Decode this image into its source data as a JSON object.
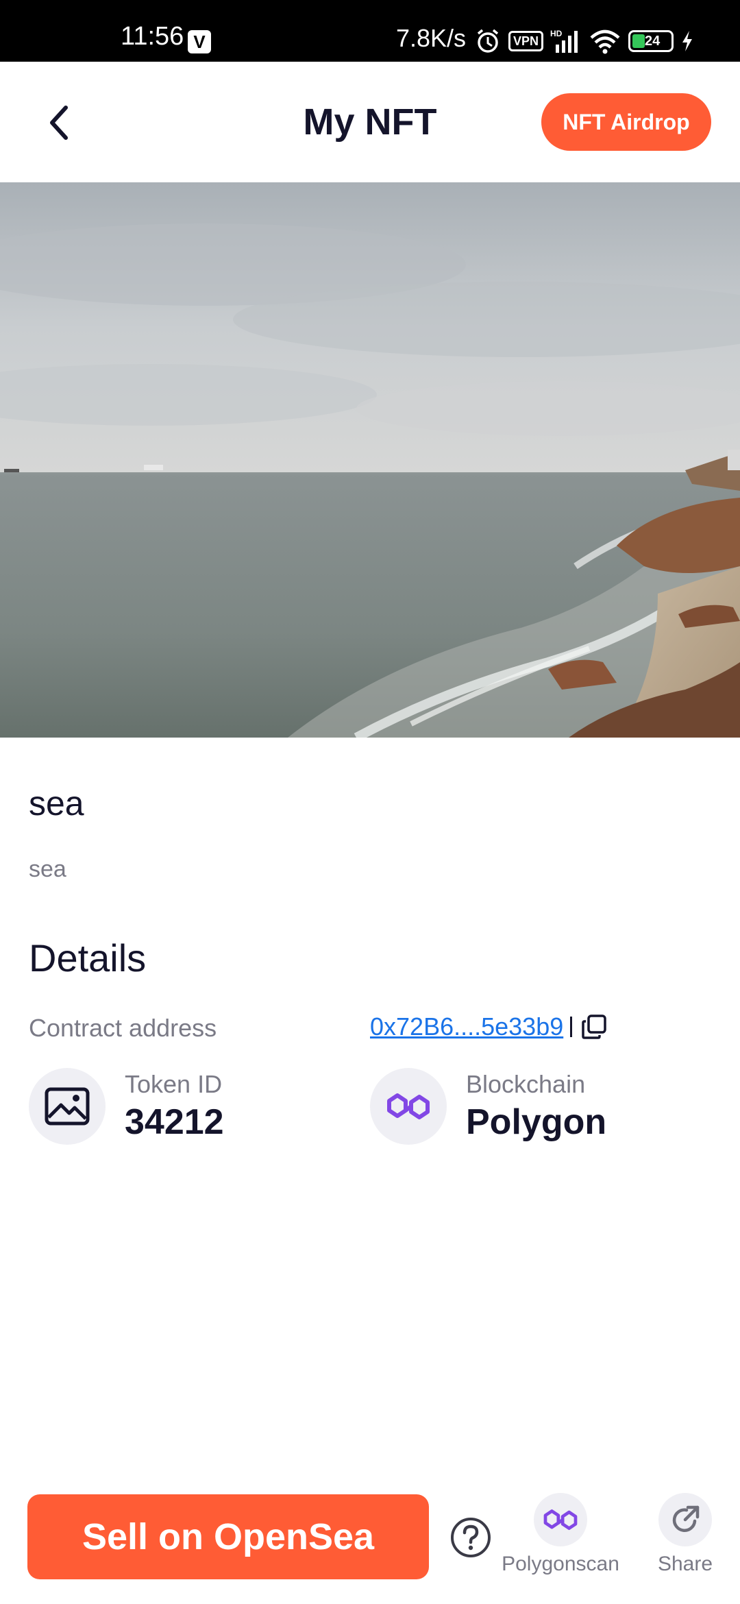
{
  "status_bar": {
    "time": "11:56",
    "notification_badge": "V",
    "network_speed": "7.8K/s",
    "vpn": "VPN",
    "battery": "24",
    "icons": [
      "alarm-icon",
      "vpn-icon",
      "signal-icon",
      "wifi-icon",
      "battery-icon",
      "charging-icon"
    ]
  },
  "header": {
    "title": "My NFT",
    "airdrop_label": "NFT Airdrop"
  },
  "nft": {
    "name": "sea",
    "description": "sea"
  },
  "details": {
    "title": "Details",
    "contract_label": "Contract address",
    "contract_value": "0x72B6....5e33b9",
    "token_label": "Token ID",
    "token_value": "34212",
    "blockchain_label": "Blockchain",
    "blockchain_value": "Polygon"
  },
  "bottom": {
    "sell_label": "Sell on OpenSea",
    "polygonscan_label": "Polygonscan",
    "share_label": "Share"
  },
  "colors": {
    "accent": "#ff5c35",
    "polygon": "#8247e5",
    "link": "#1a73e8"
  }
}
